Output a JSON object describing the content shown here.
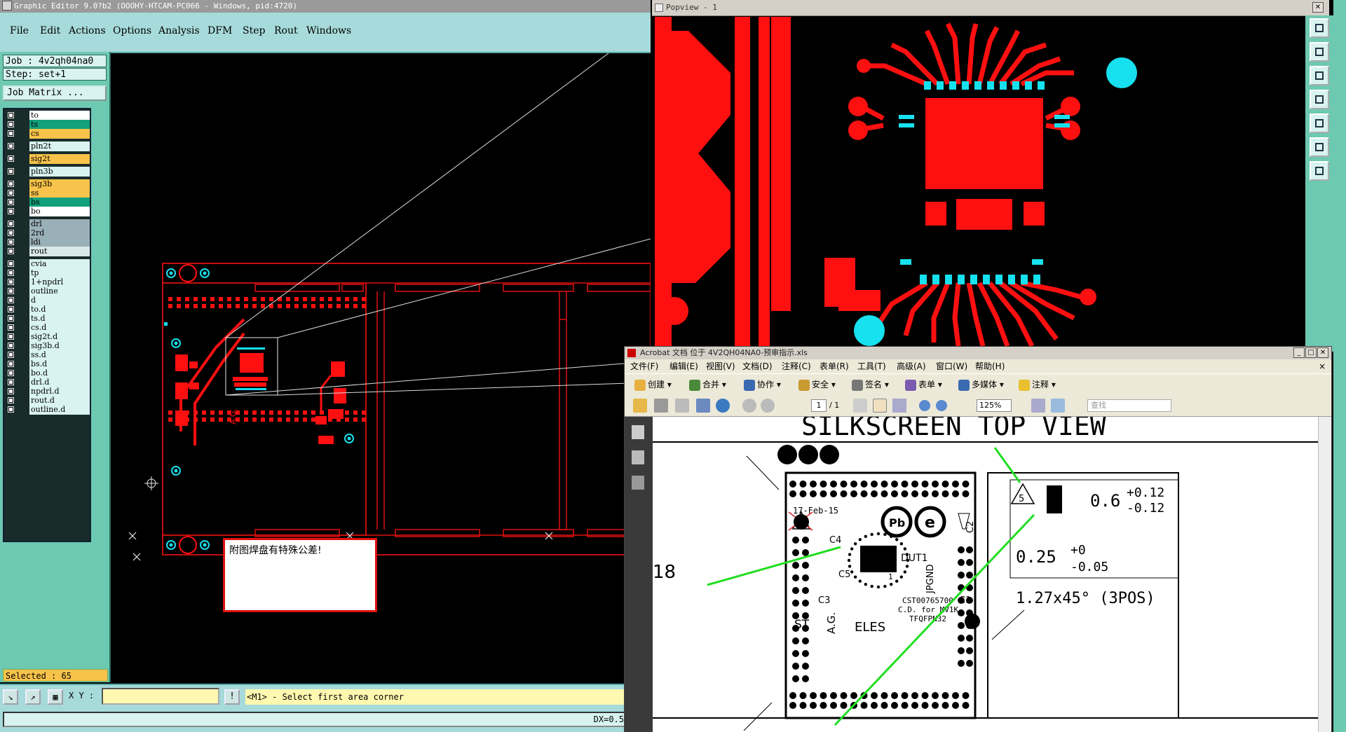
{
  "editor": {
    "title": "Graphic Editor 9.0?b2 (OOOHY-HTCAM-PC066 - Windows, pid:4720)",
    "menu": [
      "File",
      "Edit",
      "Actions",
      "Options",
      "Analysis",
      "DFM",
      "Step",
      "Rout",
      "Windows"
    ],
    "job_line": "Job : 4v2qh04na0",
    "step_line": "Step: set+1",
    "job_matrix_label": "Job Matrix ...",
    "layers": [
      {
        "name": "to",
        "color": "#ffffff"
      },
      {
        "name": "ts",
        "color": "#12a07a"
      },
      {
        "name": "cs",
        "color": "#f7c34a"
      },
      {
        "name": "pln2t",
        "color": "#d8f3f0"
      },
      {
        "name": "sig2t",
        "color": "#f7c34a"
      },
      {
        "name": "pln3b",
        "color": "#d8f3f0"
      },
      {
        "name": "sig3b",
        "color": "#f7c34a"
      },
      {
        "name": "ss",
        "color": "#f7c34a"
      },
      {
        "name": "bs",
        "color": "#12a07a"
      },
      {
        "name": "bo",
        "color": "#ffffff"
      },
      {
        "name": "drl",
        "color": "#9ab0b8"
      },
      {
        "name": "2rd",
        "color": "#9ab0b8"
      },
      {
        "name": "ldi",
        "color": "#9ab0b8"
      },
      {
        "name": "rout",
        "color": "#d8e8e8"
      },
      {
        "name": "cvia",
        "color": "#d8f3f0"
      },
      {
        "name": "tp",
        "color": "#d8f3f0"
      },
      {
        "name": "1+npdrl",
        "color": "#d8f3f0"
      },
      {
        "name": "outline",
        "color": "#d8f3f0"
      },
      {
        "name": "d",
        "color": "#d8f3f0"
      },
      {
        "name": "to.d",
        "color": "#d8f3f0"
      },
      {
        "name": "ts.d",
        "color": "#d8f3f0"
      },
      {
        "name": "cs.d",
        "color": "#d8f3f0"
      },
      {
        "name": "sig2t.d",
        "color": "#d8f3f0"
      },
      {
        "name": "sig3b.d",
        "color": "#d8f3f0"
      },
      {
        "name": "ss.d",
        "color": "#d8f3f0"
      },
      {
        "name": "bs.d",
        "color": "#d8f3f0"
      },
      {
        "name": "bo.d",
        "color": "#d8f3f0"
      },
      {
        "name": "drl.d",
        "color": "#d8f3f0"
      },
      {
        "name": "npdrl.d",
        "color": "#d8f3f0"
      },
      {
        "name": "rout.d",
        "color": "#d8f3f0"
      },
      {
        "name": "outline.d",
        "color": "#d8f3f0"
      }
    ],
    "selected": "Selected : 65",
    "xy_label": "X Y :",
    "status_message": "<M1> - Select first area corner",
    "dx_readout": "DX=0.5",
    "note_text": "附图焊盘有特殊公差!",
    "board_silk": "A.G."
  },
  "popview": {
    "title": "Popview - 1"
  },
  "acrobat": {
    "title": "Acrobat 文档 位于 4V2QH04NA0-预审指示.xls",
    "menu": [
      "文件(F)",
      "编辑(E)",
      "视图(V)",
      "文档(D)",
      "注释(C)",
      "表单(R)",
      "工具(T)",
      "高级(A)",
      "窗口(W)",
      "帮助(H)"
    ],
    "toolbar": [
      "创建",
      "合并",
      "协作",
      "安全",
      "签名",
      "表单",
      "多媒体",
      "注释"
    ],
    "page_current": "1",
    "page_total": "/ 1",
    "zoom": "125%",
    "search_placeholder": "查找",
    "doc": {
      "heading": "SILKSCREEN TOP VIEW",
      "left_num": "18",
      "date": "17-Feb-15",
      "labels": [
        "C4",
        "C5",
        "C3",
        "C1",
        "C2",
        "DUT1",
        "ST",
        "ELES",
        "JPGND",
        "A.G.",
        "1"
      ],
      "product_lines": [
        "CST00765700",
        "C.D. for MV1K",
        "TFQFPN32"
      ],
      "tol_box": {
        "triangle": "5",
        "v1": "0.6",
        "v1_plus": "+0.12",
        "v1_minus": "-0.12",
        "v2": "0.25",
        "v2_plus": "+0",
        "v2_minus": "-0.05"
      },
      "chamfer": "1.27x45° (3POS)",
      "marker": "3",
      "pb_label": "Pb",
      "e_label": "e"
    }
  },
  "colors": {
    "pcb_red": "#ff1010",
    "pad_cyan": "#17e0ef",
    "teal_panel": "#6ec9b2"
  }
}
